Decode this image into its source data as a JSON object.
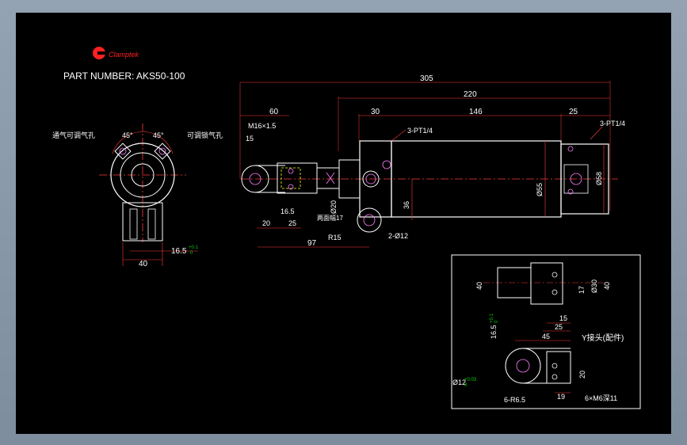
{
  "header": {
    "logo_text": "Clamptek",
    "part_number": "PART NUMBER:  AKS50-100"
  },
  "colors": {
    "dimension": "#ff3b3b",
    "label": "#ffffff",
    "tolerance": "#00d000",
    "centerline": "#ff3b3b",
    "outline": "#ffffff",
    "hidden": "#ffff00",
    "port": "#ff80ff"
  },
  "end_view": {
    "port_left_angle": "45°",
    "port_right_angle": "45°",
    "port_left_label": "通气可调气孔",
    "port_right_label": "可调锁气孔",
    "dim_width": "40",
    "dim_slot": "16.5",
    "dim_slot_tol_upper": "+0.1",
    "dim_slot_tol_lower": "0"
  },
  "side_view": {
    "dim_overall": "305",
    "dim_body": "220",
    "dim_head": "60",
    "dim_a": "30",
    "dim_b": "146",
    "dim_c": "25",
    "thread": "M16×1.5",
    "dim_15": "15",
    "dim_16_5": "16.5",
    "dim_20": "20",
    "dim_25": "25",
    "dim_97": "97",
    "radius": "R15",
    "pin_holes": "2-Ø12",
    "rod_dia": "Ø20",
    "flats": "两面幅17",
    "port_left": "3-PT1/4",
    "port_right": "3-PT1/4",
    "dim_36": "36",
    "bore_dia": "Ø55",
    "body_dia": "Ø58"
  },
  "detail": {
    "title": "Y接头(配件)",
    "dim_40_left": "40",
    "dim_17": "17",
    "dim_30": "Ø30",
    "dim_40_right": "40",
    "dim_15": "15",
    "dim_25": "25",
    "dim_45": "45",
    "slot_dim": "16.5",
    "slot_tol": "+0.1",
    "slot_tol_lower": "0",
    "hole_dim": "Ø12",
    "hole_tol": "+0.03",
    "hole_tol_lower": "0",
    "dim_20": "20",
    "dim_19": "19",
    "radius_note": "6-R6.5",
    "thread_note": "6×M6深11"
  }
}
